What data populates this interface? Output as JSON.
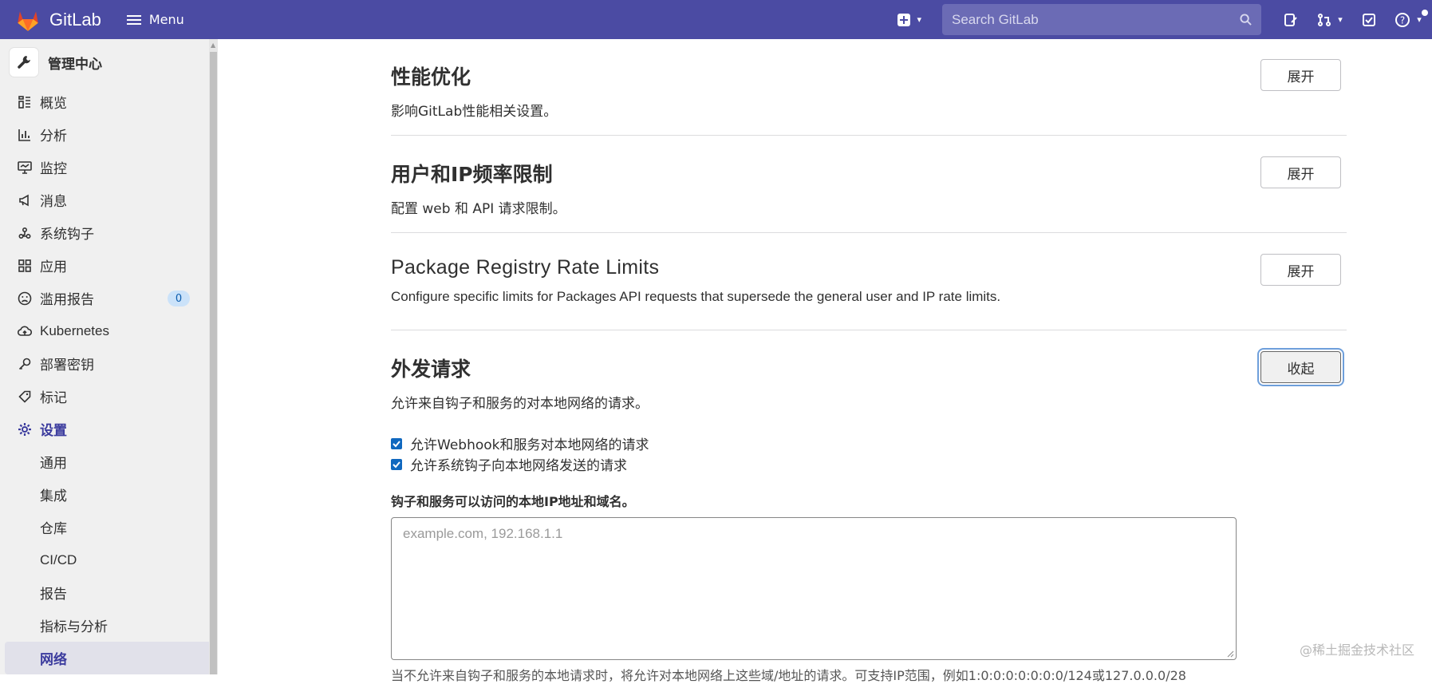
{
  "topbar": {
    "brand": "GitLab",
    "menu_label": "Menu",
    "search_placeholder": "Search GitLab",
    "colors": {
      "background": "#4b4ba3",
      "search_bg": "#6b6bb5"
    }
  },
  "sidebar": {
    "header": "管理中心",
    "items": [
      {
        "label": "概览",
        "icon": "overview-icon"
      },
      {
        "label": "分析",
        "icon": "analytics-icon"
      },
      {
        "label": "监控",
        "icon": "monitor-icon"
      },
      {
        "label": "消息",
        "icon": "messages-icon"
      },
      {
        "label": "系统钩子",
        "icon": "hook-icon"
      },
      {
        "label": "应用",
        "icon": "applications-icon"
      },
      {
        "label": "滥用报告",
        "icon": "abuse-icon",
        "badge": "0"
      },
      {
        "label": "Kubernetes",
        "icon": "kubernetes-icon"
      },
      {
        "label": "部署密钥",
        "icon": "key-icon"
      },
      {
        "label": "标记",
        "icon": "label-icon"
      },
      {
        "label": "设置",
        "icon": "settings-icon"
      }
    ],
    "sub_items": [
      "通用",
      "集成",
      "仓库",
      "CI/CD",
      "报告",
      "指标与分析",
      "网络"
    ],
    "active_sub": "网络"
  },
  "sections": [
    {
      "title": "性能优化",
      "desc": "影响GitLab性能相关设置。",
      "button": "展开"
    },
    {
      "title": "用户和IP频率限制",
      "desc": "配置 web 和 API 请求限制。",
      "button": "展开"
    },
    {
      "title": "Package Registry Rate Limits",
      "desc": "Configure specific limits for Packages API requests that supersede the general user and IP rate limits.",
      "button": "展开"
    },
    {
      "title": "外发请求",
      "desc": "允许来自钩子和服务的对本地网络的请求。",
      "button": "收起"
    }
  ],
  "outbound": {
    "checkboxes": [
      {
        "label": "允许Webhook和服务对本地网络的请求",
        "checked": true
      },
      {
        "label": "允许系统钩子向本地网络发送的请求",
        "checked": true
      }
    ],
    "field_label": "钩子和服务可以访问的本地IP地址和域名。",
    "textarea_placeholder": "example.com, 192.168.1.1",
    "textarea_value": "",
    "help": "当不允许来自钩子和服务的本地请求时，将允许对本地网络上这些域/地址的请求。可支持IP范围，例如1:0:0:0:0:0:0:0/124或127.0.0.0/28"
  },
  "watermark": "@稀土掘金技术社区"
}
